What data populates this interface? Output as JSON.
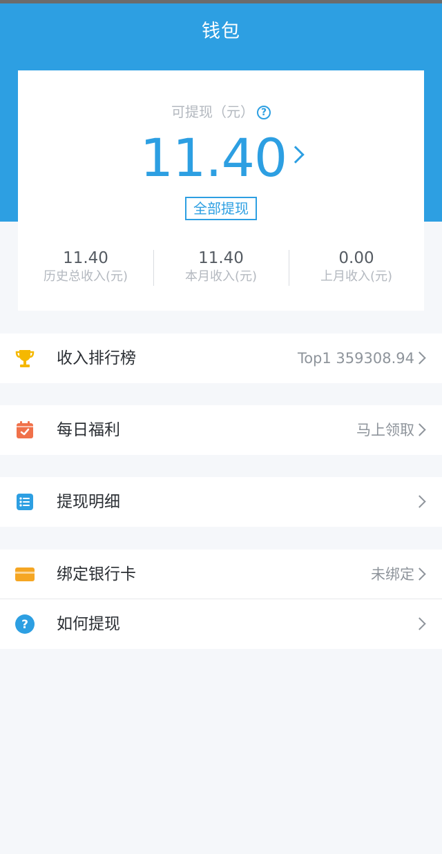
{
  "header": {
    "title": "钱包"
  },
  "wallet": {
    "available_label": "可提现（元）",
    "amount": "11.40",
    "withdraw_all_label": "全部提现",
    "stats": [
      {
        "value": "11.40",
        "label": "历史总收入(元)"
      },
      {
        "value": "11.40",
        "label": "本月收入(元)"
      },
      {
        "value": "0.00",
        "label": "上月收入(元)"
      }
    ]
  },
  "menu": [
    {
      "label": "收入排行榜",
      "value": "Top1 359308.94",
      "icon": "trophy-icon",
      "color": "#f5b800"
    },
    {
      "label": "每日福利",
      "value": "马上领取",
      "icon": "calendar-icon",
      "color": "#f0714a"
    },
    {
      "label": "提现明细",
      "value": "",
      "icon": "list-icon",
      "color": "#2d9fe2"
    },
    {
      "label": "绑定银行卡",
      "value": "未绑定",
      "icon": "card-icon",
      "color": "#f5a623"
    },
    {
      "label": "如何提现",
      "value": "",
      "icon": "question-icon",
      "color": "#2d9fe2"
    }
  ],
  "colors": {
    "primary": "#2d9fe2",
    "background": "#f5f7fa"
  }
}
